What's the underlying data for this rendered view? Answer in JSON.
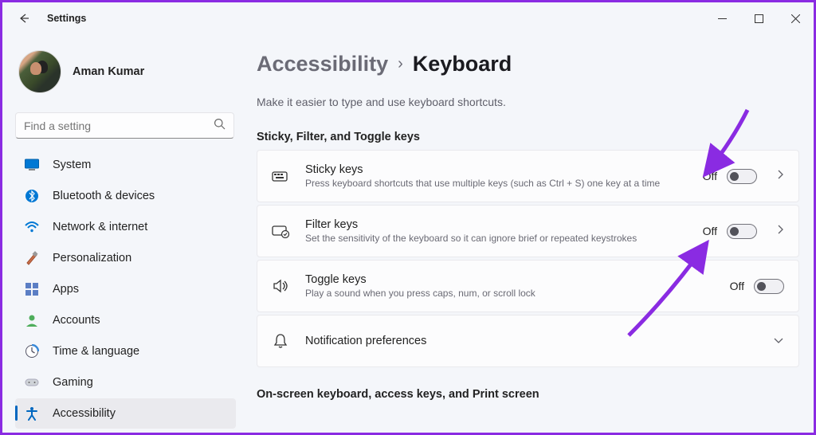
{
  "window": {
    "title": "Settings"
  },
  "profile": {
    "name": "Aman Kumar"
  },
  "search": {
    "placeholder": "Find a setting"
  },
  "sidebar": {
    "items": [
      {
        "label": "System",
        "icon": "system"
      },
      {
        "label": "Bluetooth & devices",
        "icon": "bluetooth"
      },
      {
        "label": "Network & internet",
        "icon": "wifi"
      },
      {
        "label": "Personalization",
        "icon": "brush"
      },
      {
        "label": "Apps",
        "icon": "apps"
      },
      {
        "label": "Accounts",
        "icon": "person"
      },
      {
        "label": "Time & language",
        "icon": "clock"
      },
      {
        "label": "Gaming",
        "icon": "game"
      },
      {
        "label": "Accessibility",
        "icon": "accessibility",
        "selected": true
      }
    ]
  },
  "breadcrumb": {
    "parent": "Accessibility",
    "current": "Keyboard"
  },
  "subtitle": "Make it easier to type and use keyboard shortcuts.",
  "sections": [
    {
      "header": "Sticky, Filter, and Toggle keys",
      "rows": [
        {
          "title": "Sticky keys",
          "desc": "Press keyboard shortcuts that use multiple keys (such as Ctrl + S) one key at a time",
          "state": "Off",
          "icon": "sticky",
          "chevron": true
        },
        {
          "title": "Filter keys",
          "desc": "Set the sensitivity of the keyboard so it can ignore brief or repeated keystrokes",
          "state": "Off",
          "icon": "filter",
          "chevron": true
        },
        {
          "title": "Toggle keys",
          "desc": "Play a sound when you press caps, num, or scroll lock",
          "state": "Off",
          "icon": "speaker",
          "chevron": false
        },
        {
          "title": "Notification preferences",
          "desc": "",
          "state": "",
          "icon": "bell",
          "chevron": false,
          "expand": true
        }
      ]
    },
    {
      "header": "On-screen keyboard, access keys, and Print screen",
      "rows": []
    }
  ],
  "colors": {
    "accent_arrow": "#8a2be2"
  }
}
